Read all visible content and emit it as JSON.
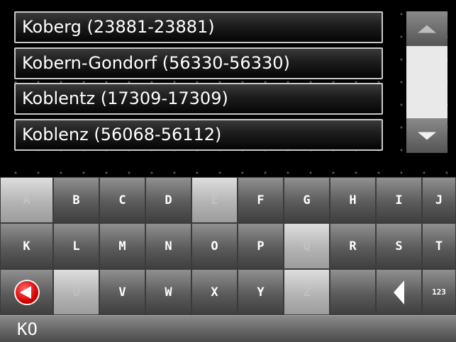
{
  "list": {
    "items": [
      {
        "label": "Koberg (23881-23881)"
      },
      {
        "label": "Kobern-Gondorf (56330-56330)"
      },
      {
        "label": "Koblentz (17309-17309)"
      },
      {
        "label": "Koblenz (56068-56112)"
      }
    ]
  },
  "scrollbar": {
    "up_icon": "arrow-up-icon",
    "down_icon": "arrow-down-icon",
    "thumb_color": "#e9e9e9"
  },
  "keyboard": {
    "rows": [
      [
        {
          "label": "A",
          "enabled": false
        },
        {
          "label": "B",
          "enabled": true
        },
        {
          "label": "C",
          "enabled": true
        },
        {
          "label": "D",
          "enabled": true
        },
        {
          "label": "E",
          "enabled": false
        },
        {
          "label": "F",
          "enabled": true
        },
        {
          "label": "G",
          "enabled": true
        },
        {
          "label": "H",
          "enabled": true
        },
        {
          "label": "I",
          "enabled": true
        },
        {
          "label": "J",
          "enabled": true
        }
      ],
      [
        {
          "label": "K",
          "enabled": true
        },
        {
          "label": "L",
          "enabled": true
        },
        {
          "label": "M",
          "enabled": true
        },
        {
          "label": "N",
          "enabled": true
        },
        {
          "label": "O",
          "enabled": true
        },
        {
          "label": "P",
          "enabled": true
        },
        {
          "label": "Q",
          "enabled": false
        },
        {
          "label": "R",
          "enabled": true
        },
        {
          "label": "S",
          "enabled": true
        },
        {
          "label": "T",
          "enabled": true
        }
      ],
      [
        {
          "label": "",
          "enabled": true,
          "icon": "back-red-icon"
        },
        {
          "label": "U",
          "enabled": false
        },
        {
          "label": "V",
          "enabled": true
        },
        {
          "label": "W",
          "enabled": true
        },
        {
          "label": "X",
          "enabled": true
        },
        {
          "label": "Y",
          "enabled": true
        },
        {
          "label": "Z",
          "enabled": false
        },
        {
          "label": "",
          "enabled": true,
          "icon": "space-key"
        },
        {
          "label": "",
          "enabled": true,
          "icon": "backspace-arrow-icon"
        },
        {
          "label": "123",
          "enabled": true
        }
      ]
    ]
  },
  "input": {
    "value": "KO"
  },
  "colors": {
    "disabled_key": "#c8c8c8",
    "enabled_key": "#6a6a6a",
    "back_button": "#d80000"
  }
}
